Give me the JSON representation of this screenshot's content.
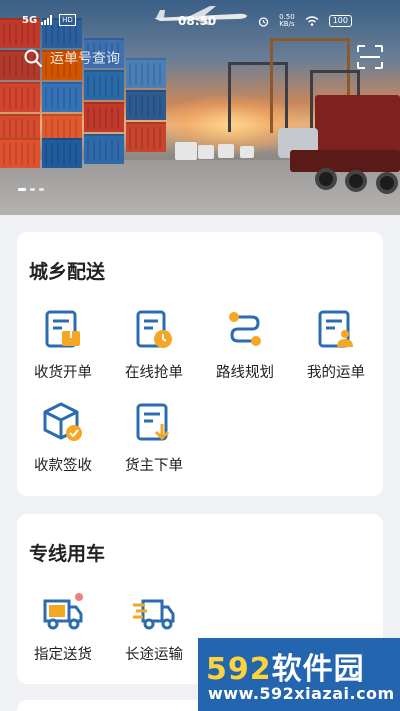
{
  "status_bar": {
    "time": "08:50",
    "network": "5G",
    "hd": "HD",
    "speed": "0.50",
    "speed_unit": "KB/s",
    "battery": "100"
  },
  "search": {
    "placeholder": "运单号查询"
  },
  "banner": {
    "slide_count": 3,
    "active_index": 0
  },
  "sections": [
    {
      "title": "城乡配送",
      "items": [
        {
          "label": "收货开单",
          "icon": "receive-order-icon"
        },
        {
          "label": "在线抢单",
          "icon": "grab-order-icon"
        },
        {
          "label": "路线规划",
          "icon": "route-plan-icon"
        },
        {
          "label": "我的运单",
          "icon": "my-waybill-icon"
        },
        {
          "label": "收款签收",
          "icon": "payment-sign-icon"
        },
        {
          "label": "货主下单",
          "icon": "shipper-order-icon"
        }
      ]
    },
    {
      "title": "专线用车",
      "items": [
        {
          "label": "指定送货",
          "icon": "designated-delivery-icon"
        },
        {
          "label": "长途运输",
          "icon": "long-haul-icon"
        }
      ]
    }
  ],
  "watermark": {
    "brand_num": "592",
    "brand_text": "软件园",
    "url": "www.592xiazai.com"
  },
  "colors": {
    "accent_blue": "#2b6cb0",
    "accent_orange": "#f5a623",
    "background": "#eff1f4"
  }
}
